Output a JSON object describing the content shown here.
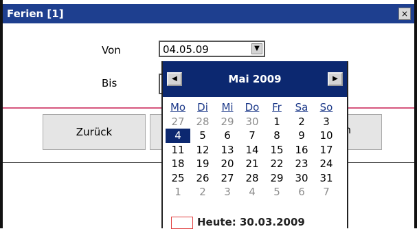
{
  "window": {
    "title": "Ferien [1]",
    "close_glyph": "×"
  },
  "form": {
    "von_label": "Von",
    "von_value": "04.05.09",
    "dropdown_glyph": "▼",
    "bis_label": "Bis"
  },
  "buttons": {
    "back_label": "Zurück",
    "partial_fragment": "n"
  },
  "calendar": {
    "month_label": "Mai 2009",
    "prev_glyph": "◀",
    "next_glyph": "▶",
    "weekdays": [
      "Mo",
      "Di",
      "Mi",
      "Do",
      "Fr",
      "Sa",
      "So"
    ],
    "weeks": [
      [
        {
          "d": "27",
          "m": true
        },
        {
          "d": "28",
          "m": true
        },
        {
          "d": "29",
          "m": true
        },
        {
          "d": "30",
          "m": true
        },
        {
          "d": "1"
        },
        {
          "d": "2"
        },
        {
          "d": "3"
        }
      ],
      [
        {
          "d": "4",
          "s": true
        },
        {
          "d": "5"
        },
        {
          "d": "6"
        },
        {
          "d": "7"
        },
        {
          "d": "8"
        },
        {
          "d": "9"
        },
        {
          "d": "10"
        }
      ],
      [
        {
          "d": "11"
        },
        {
          "d": "12"
        },
        {
          "d": "13"
        },
        {
          "d": "14"
        },
        {
          "d": "15"
        },
        {
          "d": "16"
        },
        {
          "d": "17"
        }
      ],
      [
        {
          "d": "18"
        },
        {
          "d": "19"
        },
        {
          "d": "20"
        },
        {
          "d": "21"
        },
        {
          "d": "22"
        },
        {
          "d": "23"
        },
        {
          "d": "24"
        }
      ],
      [
        {
          "d": "25"
        },
        {
          "d": "26"
        },
        {
          "d": "27"
        },
        {
          "d": "28"
        },
        {
          "d": "29"
        },
        {
          "d": "30"
        },
        {
          "d": "31"
        }
      ],
      [
        {
          "d": "1",
          "m": true
        },
        {
          "d": "2",
          "m": true
        },
        {
          "d": "3",
          "m": true
        },
        {
          "d": "4",
          "m": true
        },
        {
          "d": "5",
          "m": true
        },
        {
          "d": "6",
          "m": true
        },
        {
          "d": "7",
          "m": true
        }
      ]
    ],
    "today_label": "Heute: 30.03.2009"
  },
  "colors": {
    "titlebar": "#1e3f8f",
    "calendar_header": "#0c2870",
    "separator": "#d6567d",
    "today_marker": "#e04040"
  }
}
